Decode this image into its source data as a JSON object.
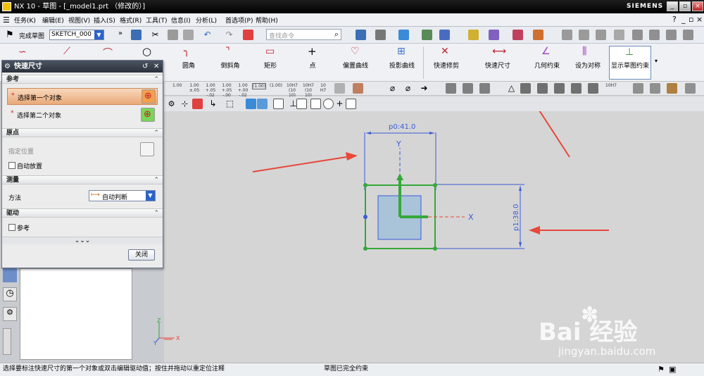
{
  "title_bar": {
    "title": "NX 10 - 草图 - [_model1.prt （修改的）]",
    "brand": "SIEMENS",
    "minimize": "_",
    "restore": "▫",
    "close": "×"
  },
  "menu": {
    "items": [
      "任务(K)",
      "编辑(E)",
      "视图(V)",
      "插入(S)",
      "格式(R)",
      "工具(T)",
      "信息(I)",
      "分析(L)",
      "首选项(P)",
      "帮助(H)"
    ]
  },
  "toolbar": {
    "finish_sketch": "完成草图",
    "sketch_name": "SKETCH_000",
    "search_placeholder": "查找命令"
  },
  "ribbon": {
    "items": [
      "",
      "",
      "",
      "",
      "圆角",
      "倒斜角",
      "矩形",
      "点",
      "偏置曲线",
      "投影曲线",
      "快速修剪",
      "快速尺寸",
      "几何约束",
      "设为对称",
      "显示草图约束"
    ]
  },
  "dim_toolbar": {
    "labels": [
      "1.00",
      "1.00 ±.05",
      "1.00 +.05 -.02",
      "1.00 +.05 -.00",
      "1.00 +.00 -.02",
      "(1.00)",
      "(1.00)",
      "10H7 (10 10)",
      "10H7 (10 10)",
      "10 H7",
      "10H7"
    ]
  },
  "dialog": {
    "title": "快速尺寸",
    "sections": {
      "reference": "参考",
      "origin": "原点",
      "measurement": "测量",
      "driving": "驱动"
    },
    "first_object": "选择第一个对象",
    "second_object": "选择第二个对象",
    "specify_location": "指定位置",
    "auto_place": "自动放置",
    "method_label": "方法",
    "method_value": "自动判断",
    "reference_checkbox": "参考",
    "more": "⌄⌄⌄",
    "close": "关闭",
    "required_mark": "*"
  },
  "sketch": {
    "dim_horizontal": "p0:41.0",
    "dim_vertical": "p1:38.0",
    "axis_x": "X",
    "axis_y": "Y"
  },
  "triad": {
    "x": "X",
    "y": "Y",
    "z": "Z"
  },
  "status": {
    "left": "选择要标注快速尺寸的第一个对象或双击编辑驱动值；按住并拖动以重定位注释",
    "right": "草图已完全约束"
  },
  "watermark": {
    "brand": "Bai 经验",
    "url": "jingyan.baidu.com"
  },
  "colors": {
    "accent": "#e9a979",
    "sketch_green": "#35a83a",
    "dimension_blue": "#3b5bd6",
    "arrow_red": "#e8473a",
    "square_fill": "#a9c3d8"
  }
}
